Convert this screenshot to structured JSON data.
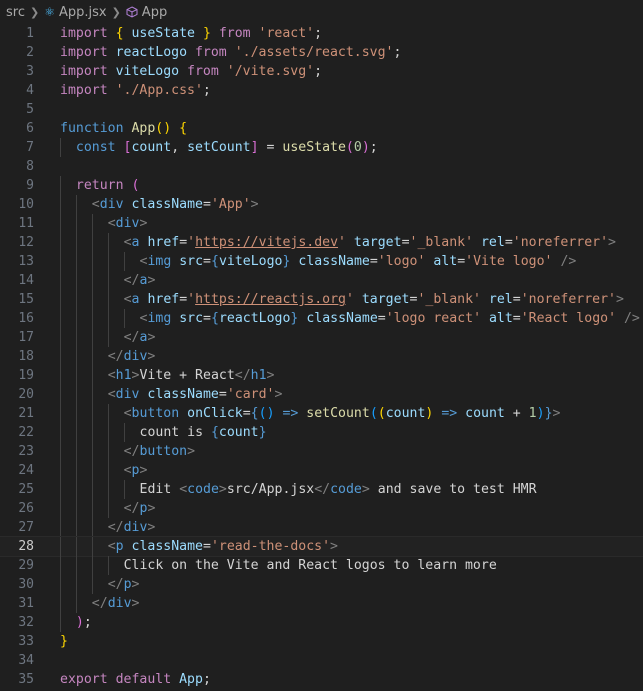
{
  "breadcrumb": {
    "folder": "src",
    "file": "App.jsx",
    "symbol": "App"
  },
  "editor": {
    "current_line": 28,
    "lines": [
      {
        "n": "1",
        "tokens": [
          [
            "kw",
            "import "
          ],
          [
            "b1",
            "{ "
          ],
          [
            "var",
            "useState"
          ],
          [
            "b1",
            " }"
          ],
          [
            "kw",
            " from "
          ],
          [
            "str",
            "'react'"
          ],
          [
            "txt",
            ";"
          ]
        ]
      },
      {
        "n": "2",
        "tokens": [
          [
            "kw",
            "import "
          ],
          [
            "var",
            "reactLogo"
          ],
          [
            "kw",
            " from "
          ],
          [
            "str",
            "'./assets/react.svg'"
          ],
          [
            "txt",
            ";"
          ]
        ]
      },
      {
        "n": "3",
        "tokens": [
          [
            "kw",
            "import "
          ],
          [
            "var",
            "viteLogo"
          ],
          [
            "kw",
            " from "
          ],
          [
            "str",
            "'/vite.svg'"
          ],
          [
            "txt",
            ";"
          ]
        ]
      },
      {
        "n": "4",
        "tokens": [
          [
            "kw",
            "import "
          ],
          [
            "str",
            "'./App.css'"
          ],
          [
            "txt",
            ";"
          ]
        ]
      },
      {
        "n": "5",
        "tokens": []
      },
      {
        "n": "6",
        "tokens": [
          [
            "st",
            "function "
          ],
          [
            "fn",
            "App"
          ],
          [
            "b1",
            "() {"
          ]
        ]
      },
      {
        "n": "7",
        "indent": 1,
        "tokens": [
          [
            "st",
            "const "
          ],
          [
            "b2",
            "["
          ],
          [
            "var",
            "count"
          ],
          [
            "txt",
            ", "
          ],
          [
            "var",
            "setCount"
          ],
          [
            "b2",
            "]"
          ],
          [
            "txt",
            " = "
          ],
          [
            "fn",
            "useState"
          ],
          [
            "b2",
            "("
          ],
          [
            "num",
            "0"
          ],
          [
            "b2",
            ")"
          ],
          [
            "txt",
            ";"
          ]
        ]
      },
      {
        "n": "8",
        "tokens": []
      },
      {
        "n": "9",
        "indent": 1,
        "tokens": [
          [
            "kw",
            "return "
          ],
          [
            "b2",
            "("
          ]
        ]
      },
      {
        "n": "10",
        "indent": 2,
        "tokens": [
          [
            "br",
            "<"
          ],
          [
            "tag",
            "div"
          ],
          [
            "attr",
            " className"
          ],
          [
            "txt",
            "="
          ],
          [
            "str",
            "'App'"
          ],
          [
            "br",
            ">"
          ]
        ]
      },
      {
        "n": "11",
        "indent": 3,
        "tokens": [
          [
            "br",
            "<"
          ],
          [
            "tag",
            "div"
          ],
          [
            "br",
            ">"
          ]
        ]
      },
      {
        "n": "12",
        "indent": 4,
        "tokens": [
          [
            "br",
            "<"
          ],
          [
            "tag",
            "a"
          ],
          [
            "attr",
            " href"
          ],
          [
            "txt",
            "="
          ],
          [
            "str",
            "'"
          ],
          [
            "url",
            "https://vitejs.dev"
          ],
          [
            "str",
            "'"
          ],
          [
            "attr",
            " target"
          ],
          [
            "txt",
            "="
          ],
          [
            "str",
            "'_blank'"
          ],
          [
            "attr",
            " rel"
          ],
          [
            "txt",
            "="
          ],
          [
            "str",
            "'noreferrer'"
          ],
          [
            "br",
            ">"
          ]
        ]
      },
      {
        "n": "13",
        "indent": 5,
        "tokens": [
          [
            "br",
            "<"
          ],
          [
            "tag",
            "img"
          ],
          [
            "attr",
            " src"
          ],
          [
            "txt",
            "="
          ],
          [
            "tag",
            "{"
          ],
          [
            "var",
            "viteLogo"
          ],
          [
            "tag",
            "}"
          ],
          [
            "attr",
            " className"
          ],
          [
            "txt",
            "="
          ],
          [
            "str",
            "'logo'"
          ],
          [
            "attr",
            " alt"
          ],
          [
            "txt",
            "="
          ],
          [
            "str",
            "'Vite logo'"
          ],
          [
            "br",
            " />"
          ]
        ]
      },
      {
        "n": "14",
        "indent": 4,
        "tokens": [
          [
            "br",
            "</"
          ],
          [
            "tag",
            "a"
          ],
          [
            "br",
            ">"
          ]
        ]
      },
      {
        "n": "15",
        "indent": 4,
        "tokens": [
          [
            "br",
            "<"
          ],
          [
            "tag",
            "a"
          ],
          [
            "attr",
            " href"
          ],
          [
            "txt",
            "="
          ],
          [
            "str",
            "'"
          ],
          [
            "url",
            "https://reactjs.org"
          ],
          [
            "str",
            "'"
          ],
          [
            "attr",
            " target"
          ],
          [
            "txt",
            "="
          ],
          [
            "str",
            "'_blank'"
          ],
          [
            "attr",
            " rel"
          ],
          [
            "txt",
            "="
          ],
          [
            "str",
            "'noreferrer'"
          ],
          [
            "br",
            ">"
          ]
        ]
      },
      {
        "n": "16",
        "indent": 5,
        "tokens": [
          [
            "br",
            "<"
          ],
          [
            "tag",
            "img"
          ],
          [
            "attr",
            " src"
          ],
          [
            "txt",
            "="
          ],
          [
            "tag",
            "{"
          ],
          [
            "var",
            "reactLogo"
          ],
          [
            "tag",
            "}"
          ],
          [
            "attr",
            " className"
          ],
          [
            "txt",
            "="
          ],
          [
            "str",
            "'logo react'"
          ],
          [
            "attr",
            " alt"
          ],
          [
            "txt",
            "="
          ],
          [
            "str",
            "'React logo'"
          ],
          [
            "br",
            " />"
          ]
        ]
      },
      {
        "n": "17",
        "indent": 4,
        "tokens": [
          [
            "br",
            "</"
          ],
          [
            "tag",
            "a"
          ],
          [
            "br",
            ">"
          ]
        ]
      },
      {
        "n": "18",
        "indent": 3,
        "tokens": [
          [
            "br",
            "</"
          ],
          [
            "tag",
            "div"
          ],
          [
            "br",
            ">"
          ]
        ]
      },
      {
        "n": "19",
        "indent": 3,
        "tokens": [
          [
            "br",
            "<"
          ],
          [
            "tag",
            "h1"
          ],
          [
            "br",
            ">"
          ],
          [
            "txt",
            "Vite + React"
          ],
          [
            "br",
            "</"
          ],
          [
            "tag",
            "h1"
          ],
          [
            "br",
            ">"
          ]
        ]
      },
      {
        "n": "20",
        "indent": 3,
        "tokens": [
          [
            "br",
            "<"
          ],
          [
            "tag",
            "div"
          ],
          [
            "attr",
            " className"
          ],
          [
            "txt",
            "="
          ],
          [
            "str",
            "'card'"
          ],
          [
            "br",
            ">"
          ]
        ]
      },
      {
        "n": "21",
        "indent": 4,
        "tokens": [
          [
            "br",
            "<"
          ],
          [
            "tag",
            "button"
          ],
          [
            "attr",
            " onClick"
          ],
          [
            "txt",
            "="
          ],
          [
            "tag",
            "{"
          ],
          [
            "b3",
            "() "
          ],
          [
            "st",
            "=>"
          ],
          [
            "fn",
            " setCount"
          ],
          [
            "b3",
            "("
          ],
          [
            "b1",
            "("
          ],
          [
            "var",
            "count"
          ],
          [
            "b1",
            ")"
          ],
          [
            "st",
            " =>"
          ],
          [
            "var",
            " count"
          ],
          [
            "txt",
            " + "
          ],
          [
            "num",
            "1"
          ],
          [
            "b3",
            ")"
          ],
          [
            "tag",
            "}"
          ],
          [
            "br",
            ">"
          ]
        ]
      },
      {
        "n": "22",
        "indent": 5,
        "tokens": [
          [
            "txt",
            "count is "
          ],
          [
            "tag",
            "{"
          ],
          [
            "var",
            "count"
          ],
          [
            "tag",
            "}"
          ]
        ]
      },
      {
        "n": "23",
        "indent": 4,
        "tokens": [
          [
            "br",
            "</"
          ],
          [
            "tag",
            "button"
          ],
          [
            "br",
            ">"
          ]
        ]
      },
      {
        "n": "24",
        "indent": 4,
        "tokens": [
          [
            "br",
            "<"
          ],
          [
            "tag",
            "p"
          ],
          [
            "br",
            ">"
          ]
        ]
      },
      {
        "n": "25",
        "indent": 5,
        "tokens": [
          [
            "txt",
            "Edit "
          ],
          [
            "br",
            "<"
          ],
          [
            "tag",
            "code"
          ],
          [
            "br",
            ">"
          ],
          [
            "txt",
            "src/App.jsx"
          ],
          [
            "br",
            "</"
          ],
          [
            "tag",
            "code"
          ],
          [
            "br",
            ">"
          ],
          [
            "txt",
            " and save to test HMR"
          ]
        ]
      },
      {
        "n": "26",
        "indent": 4,
        "tokens": [
          [
            "br",
            "</"
          ],
          [
            "tag",
            "p"
          ],
          [
            "br",
            ">"
          ]
        ]
      },
      {
        "n": "27",
        "indent": 3,
        "tokens": [
          [
            "br",
            "</"
          ],
          [
            "tag",
            "div"
          ],
          [
            "br",
            ">"
          ]
        ]
      },
      {
        "n": "28",
        "indent": 3,
        "tokens": [
          [
            "br",
            "<"
          ],
          [
            "tag",
            "p"
          ],
          [
            "attr",
            " className"
          ],
          [
            "txt",
            "="
          ],
          [
            "str",
            "'read-the-docs'"
          ],
          [
            "br",
            ">"
          ]
        ]
      },
      {
        "n": "29",
        "indent": 4,
        "tokens": [
          [
            "txt",
            "Click on the Vite and React logos to learn more"
          ]
        ]
      },
      {
        "n": "30",
        "indent": 3,
        "tokens": [
          [
            "br",
            "</"
          ],
          [
            "tag",
            "p"
          ],
          [
            "br",
            ">"
          ]
        ]
      },
      {
        "n": "31",
        "indent": 2,
        "tokens": [
          [
            "br",
            "</"
          ],
          [
            "tag",
            "div"
          ],
          [
            "br",
            ">"
          ]
        ]
      },
      {
        "n": "32",
        "indent": 1,
        "tokens": [
          [
            "b2",
            ")"
          ],
          [
            "txt",
            ";"
          ]
        ]
      },
      {
        "n": "33",
        "tokens": [
          [
            "b1",
            "}"
          ]
        ]
      },
      {
        "n": "34",
        "tokens": []
      },
      {
        "n": "35",
        "tokens": [
          [
            "kw",
            "export "
          ],
          [
            "kw",
            "default "
          ],
          [
            "var",
            "App"
          ],
          [
            "txt",
            ";"
          ]
        ]
      }
    ]
  }
}
